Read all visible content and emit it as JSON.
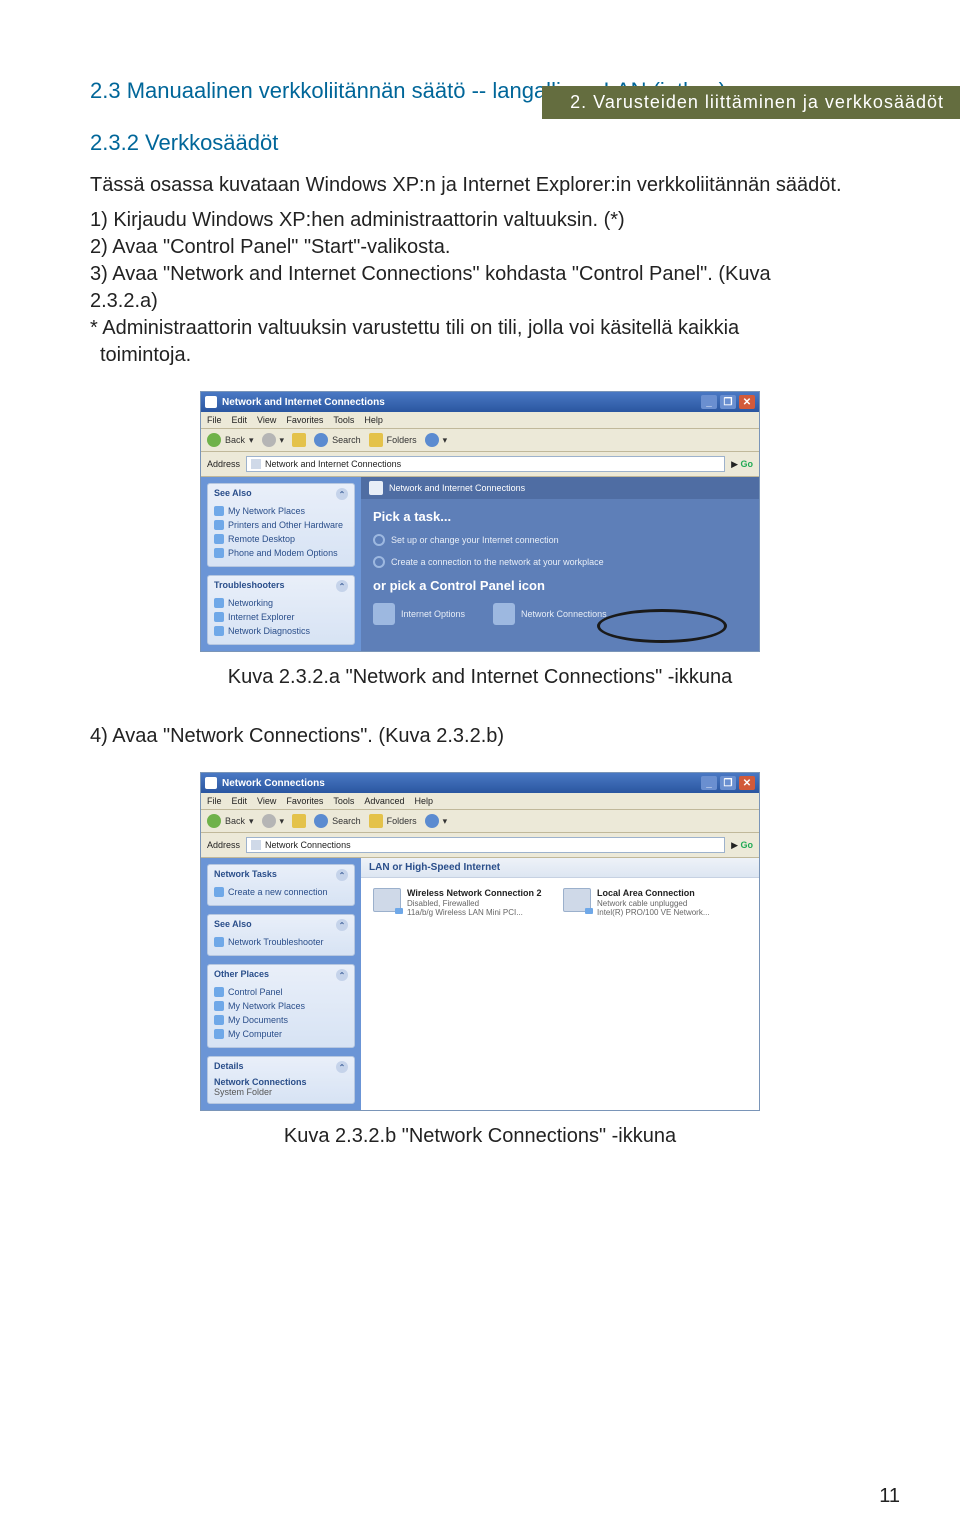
{
  "header": "2. Varusteiden liittäminen ja verkkosäädöt",
  "section_title": "2.3 Manuaalinen verkkoliitännän säätö -- langallinen LAN (jatkuu)",
  "subsection_title": "2.3.2 Verkkosäädöt",
  "intro": "Tässä osassa kuvataan Windows XP:n ja Internet Explorer:in verkkoliitännän säädöt.",
  "step1": "1) Kirjaudu Windows XP:hen administraattorin valtuuksin. (*)",
  "step2": "2) Avaa \"Control Panel\" \"Start\"-valikosta.",
  "step3a": "3) Avaa \"Network and Internet Connections\" kohdasta \"Control Panel\". (Kuva",
  "step3b": "2.3.2.a)",
  "note1": "* Administraattorin valtuuksin varustettu tili on tili, jolla voi käsitellä kaikkia",
  "note2": "toimintoja.",
  "caption1": "Kuva 2.3.2.a \"Network and Internet Connections\" -ikkuna",
  "step4": "4) Avaa \"Network Connections\". (Kuva 2.3.2.b)",
  "caption2": "Kuva 2.3.2.b \"Network Connections\" -ikkuna",
  "page_num": "11",
  "win1": {
    "title": "Network and Internet Connections",
    "menu": [
      "File",
      "Edit",
      "View",
      "Favorites",
      "Tools",
      "Help"
    ],
    "tb_back": "Back",
    "tb_search": "Search",
    "tb_folders": "Folders",
    "addr_label": "Address",
    "addr_value": "Network and Internet Connections",
    "go": "Go",
    "see_also": "See Also",
    "see_items": [
      "My Network Places",
      "Printers and Other Hardware",
      "Remote Desktop",
      "Phone and Modem Options"
    ],
    "trouble": "Troubleshooters",
    "trouble_items": [
      "Networking",
      "Internet Explorer",
      "Network Diagnostics"
    ],
    "cat": "Network and Internet Connections",
    "pick": "Pick a task...",
    "task1": "Set up or change your Internet connection",
    "task2": "Create a connection to the network at your workplace",
    "orpick": "or pick a Control Panel icon",
    "icon1": "Internet Options",
    "icon2": "Network Connections"
  },
  "win2": {
    "title": "Network Connections",
    "menu": [
      "File",
      "Edit",
      "View",
      "Favorites",
      "Tools",
      "Advanced",
      "Help"
    ],
    "tb_back": "Back",
    "tb_search": "Search",
    "tb_folders": "Folders",
    "addr_label": "Address",
    "addr_value": "Network Connections",
    "go": "Go",
    "nettasks": "Network Tasks",
    "nettasks_items": [
      "Create a new connection"
    ],
    "see_also": "See Also",
    "see_items": [
      "Network Troubleshooter"
    ],
    "other": "Other Places",
    "other_items": [
      "Control Panel",
      "My Network Places",
      "My Documents",
      "My Computer"
    ],
    "details": "Details",
    "details_name": "Network Connections",
    "details_sub": "System Folder",
    "group": "LAN or High-Speed Internet",
    "c1n": "Wireless Network Connection 2",
    "c1s1": "Disabled, Firewalled",
    "c1s2": "11a/b/g Wireless LAN Mini PCI...",
    "c2n": "Local Area Connection",
    "c2s1": "Network cable unplugged",
    "c2s2": "Intel(R) PRO/100 VE Network..."
  }
}
